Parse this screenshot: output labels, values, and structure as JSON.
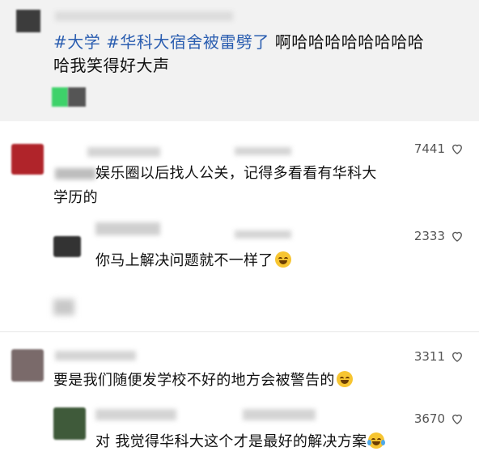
{
  "post": {
    "hashtag1": "#大学",
    "hashtag2": "#华科大宿舍被雷劈了",
    "text_line1": "啊哈哈哈哈哈哈哈哈",
    "text_line2": "哈我笑得好大声"
  },
  "comments": [
    {
      "likes": "7441",
      "text_line1": "娱乐圈以后找人公关，记得多看看有华科大",
      "text_line2": "学历的",
      "avatar_color": "#b0242a"
    },
    {
      "likes": "2333",
      "text": "你马上解决问题就不一样了",
      "avatar_color": "#333333"
    },
    {
      "likes": "3311",
      "text": "要是我们随便发学校不好的地方会被警告的",
      "avatar_color": "#7a6a6a"
    },
    {
      "likes": "3670",
      "text": "对 我觉得华科大这个才是最好的解决方案",
      "avatar_color": "#3f5a3a"
    }
  ],
  "icons": {
    "like": "heart-outline-icon",
    "emoji": "laughing-crying-emoji-icon"
  },
  "colors": {
    "hashtag": "#2a5db0",
    "post_background": "#f2f2f2"
  }
}
